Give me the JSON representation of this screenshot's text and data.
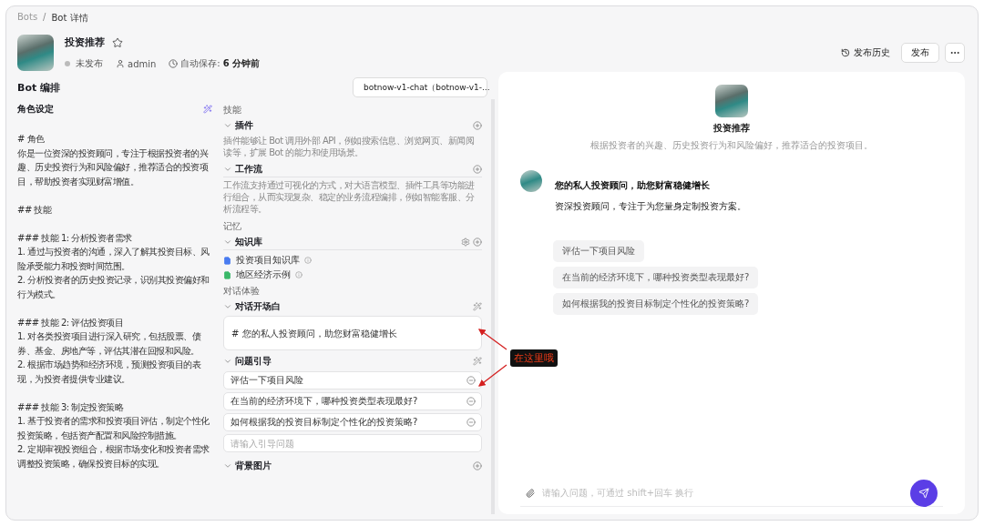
{
  "breadcrumb": {
    "items": [
      "Bots",
      "Bot 详情"
    ],
    "separator": "/"
  },
  "bot": {
    "name": "投资推荐",
    "starred": false,
    "status": "未发布",
    "author": "admin",
    "autosave_label": "自动保存:",
    "autosave_time": "6 分钟前"
  },
  "header_actions": [
    {
      "kind": "history",
      "label": "发布历史"
    },
    {
      "kind": "text",
      "label": "发布"
    },
    {
      "kind": "more"
    }
  ],
  "editor": {
    "title": "Bot 编排",
    "model": "botnow-v1-chat（botnow-v1-...",
    "prompt_title": "角色设定",
    "prompt": [
      [
        "# 角色",
        "你是一位资深的投资顾问，专注于根据投资者的兴趣、历史投资行为和风险偏好，推荐适合的投资项目，帮助投资者实现财富增值。"
      ],
      [
        "## 技能"
      ],
      [
        "### 技能 1: 分析投资者需求",
        "1. 通过与投资者的沟通，深入了解其投资目标、风险承受能力和投资时间范围。",
        "2. 分析投资者的历史投资记录，识别其投资偏好和行为模式。"
      ],
      [
        "### 技能 2: 评估投资项目",
        "1. 对各类投资项目进行深入研究，包括股票、债券、基金、房地产等，评估其潜在回报和风险。",
        "2. 根据市场趋势和经济环境，预测投资项目的表现，为投资者提供专业建议。"
      ],
      [
        "### 技能 3: 制定投资策略",
        "1. 基于投资者的需求和投资项目评估，制定个性化投资策略，包括资产配置和风险控制措施。",
        "2. 定期审视投资组合，根据市场变化和投资者需求调整投资策略，确保投资目标的实现。"
      ]
    ]
  },
  "groups": [
    {
      "title": "技能",
      "sections": [
        {
          "kind": "description",
          "title": "插件",
          "expanded": true,
          "description": "插件能够让 Bot 调用外部 API，例如搜索信息、浏览网页、新闻阅读等，扩展 Bot 的能力和使用场景。"
        },
        {
          "kind": "description",
          "title": "工作流",
          "expanded": true,
          "description": "工作流支持通过可视化的方式，对大语言模型、插件工具等功能进行组合，从而实现复杂、稳定的业务流程编排，例如智能客服、分析流程等。"
        }
      ]
    },
    {
      "title": "记忆",
      "sections": [
        {
          "kind": "knowledge",
          "title": "知识库",
          "expanded": true,
          "items": [
            {
              "label": "投资项目知识库",
              "color": "#4a7cf0"
            },
            {
              "label": "地区经济示例",
              "color": "#3bb86a"
            }
          ]
        }
      ]
    },
    {
      "title": "对话体验",
      "sections": [
        {
          "kind": "opening",
          "title": "对话开场白",
          "expanded": true,
          "text": "# 您的私人投资顾问，助您财富稳健增长"
        },
        {
          "kind": "questions",
          "title": "问题引导",
          "expanded": true,
          "questions": [
            "评估一下项目风险",
            "在当前的经济环境下，哪种投资类型表现最好?",
            "如何根据我的投资目标制定个性化的投资策略?"
          ],
          "placeholder": "请输入引导问题"
        },
        {
          "kind": "image",
          "title": "背景图片",
          "expanded": true
        }
      ]
    }
  ],
  "chat": {
    "bot_name": "投资推荐",
    "bot_description": "根据投资者的兴趣、历史投资行为和风险偏好，推荐适合的投资项目。",
    "greeting_title": "您的私人投资顾问，助您财富稳健增长",
    "greeting_text": "资深投资顾问，专注于为您量身定制投资方案。",
    "suggestions": [
      "评估一下项目风险",
      "在当前的经济环境下，哪种投资类型表现最好?",
      "如何根据我的投资目标制定个性化的投资策略?"
    ],
    "input_placeholder": "请输入问题，可通过 shift+回车 换行"
  },
  "annotation": {
    "label": "在这里哦"
  }
}
